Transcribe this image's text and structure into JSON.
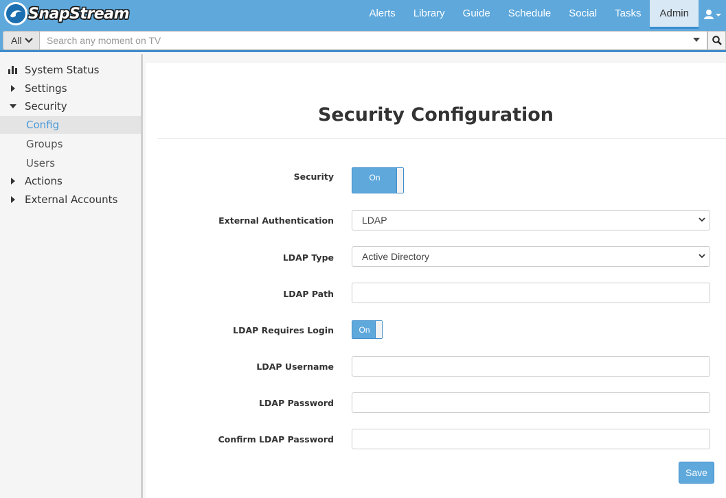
{
  "app": {
    "logo_text": "SnapStream"
  },
  "nav": {
    "items": [
      {
        "label": "Alerts"
      },
      {
        "label": "Library"
      },
      {
        "label": "Guide"
      },
      {
        "label": "Schedule"
      },
      {
        "label": "Social"
      },
      {
        "label": "Tasks"
      },
      {
        "label": "Admin",
        "active": true
      }
    ],
    "user_icon": "user-icon"
  },
  "search": {
    "scope": "All",
    "placeholder": "Search any moment on TV",
    "value": ""
  },
  "sidebar": {
    "items": [
      {
        "label": "System Status",
        "icon": "bar-chart-icon"
      },
      {
        "label": "Settings",
        "icon": "caret-right-icon"
      },
      {
        "label": "Security",
        "icon": "caret-down-icon"
      },
      {
        "label": "Config",
        "active": true
      },
      {
        "label": "Groups"
      },
      {
        "label": "Users"
      },
      {
        "label": "Actions",
        "icon": "caret-right-icon"
      },
      {
        "label": "External Accounts",
        "icon": "caret-right-icon"
      }
    ]
  },
  "page": {
    "title": "Security Configuration"
  },
  "form": {
    "security": {
      "label": "Security",
      "state": "On"
    },
    "external_auth": {
      "label": "External Authentication",
      "value": "LDAP"
    },
    "ldap_type": {
      "label": "LDAP Type",
      "value": "Active Directory"
    },
    "ldap_path": {
      "label": "LDAP Path",
      "value": ""
    },
    "ldap_requires_login": {
      "label": "LDAP Requires Login",
      "state": "On"
    },
    "ldap_username": {
      "label": "LDAP Username",
      "value": ""
    },
    "ldap_password": {
      "label": "LDAP Password",
      "value": ""
    },
    "confirm_ldap_password": {
      "label": "Confirm LDAP Password",
      "value": ""
    },
    "save_label": "Save"
  },
  "colors": {
    "accent": "#5ea8dc",
    "accent_dark": "#3e8ccb",
    "active_link": "#4a9ad8"
  }
}
